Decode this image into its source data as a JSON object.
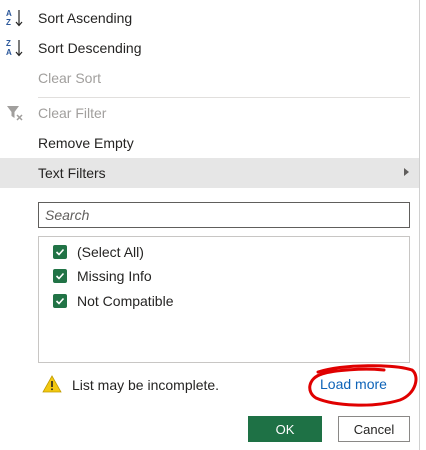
{
  "menu": {
    "sort_ascending": "Sort Ascending",
    "sort_descending": "Sort Descending",
    "clear_sort": "Clear Sort",
    "clear_filter": "Clear Filter",
    "remove_empty": "Remove Empty",
    "text_filters": "Text Filters"
  },
  "search": {
    "placeholder": "Search"
  },
  "values_list": [
    {
      "label": "(Select All)",
      "checked": true
    },
    {
      "label": "Missing Info",
      "checked": true
    },
    {
      "label": "Not Compatible",
      "checked": true
    }
  ],
  "warning": {
    "text": "List may be incomplete."
  },
  "load_more": "Load more",
  "buttons": {
    "ok": "OK",
    "cancel": "Cancel"
  },
  "colors": {
    "accent_green": "#217346",
    "ok_button": "#1e7145",
    "link_blue": "#0e63b8",
    "annotation_red": "#e00000",
    "warning_yellow": "#f2c811"
  }
}
